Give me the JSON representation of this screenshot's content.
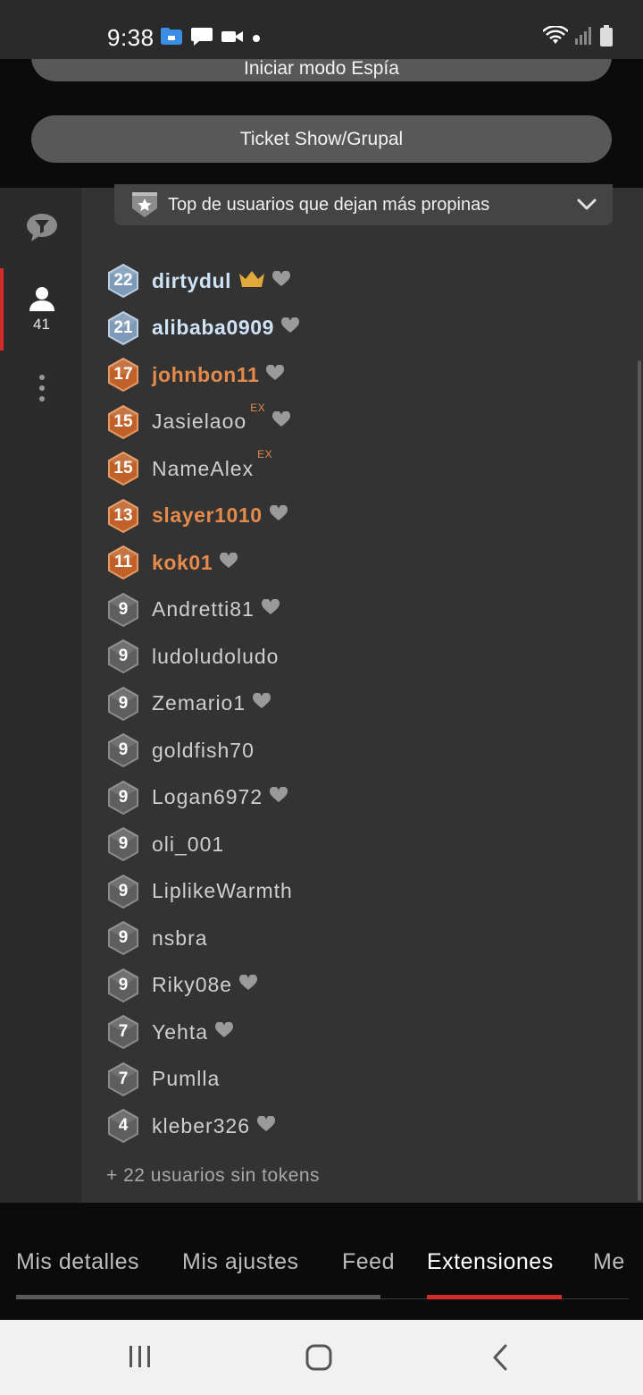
{
  "status_bar": {
    "time": "9:38",
    "left_icons": [
      "files-icon",
      "message-icon",
      "video-icon",
      "dot-icon"
    ],
    "right_icons": [
      "wifi-icon",
      "signal-icon",
      "battery-icon"
    ]
  },
  "top_buttons": {
    "spy_mode": "Iniciar modo Espía",
    "ticket_show": "Ticket Show/Grupal"
  },
  "side_rail": {
    "items": [
      {
        "name": "chat-filter-icon"
      },
      {
        "name": "users-icon",
        "count": "41",
        "active": true
      },
      {
        "name": "more-options-icon"
      }
    ]
  },
  "dropdown": {
    "label": "Top de usuarios que dejan más propinas",
    "icon": "star-badge-icon",
    "chevron": "chevron-down-icon"
  },
  "users": [
    {
      "level": "22",
      "name": "dirtydul",
      "tier": "blue",
      "crown": true,
      "heart": true,
      "ex": ""
    },
    {
      "level": "21",
      "name": "alibaba0909",
      "tier": "blue",
      "crown": false,
      "heart": true,
      "ex": ""
    },
    {
      "level": "17",
      "name": "johnbon11",
      "tier": "orange",
      "crown": false,
      "heart": true,
      "ex": ""
    },
    {
      "level": "15",
      "name": "Jasielaoo",
      "tier": "orange-badge",
      "crown": false,
      "heart": true,
      "ex": "EX"
    },
    {
      "level": "15",
      "name": "NameAlex",
      "tier": "orange-badge",
      "crown": false,
      "heart": false,
      "ex": "EX"
    },
    {
      "level": "13",
      "name": "slayer1010",
      "tier": "orange",
      "crown": false,
      "heart": true,
      "ex": ""
    },
    {
      "level": "11",
      "name": "kok01",
      "tier": "orange",
      "crown": false,
      "heart": true,
      "ex": ""
    },
    {
      "level": "9",
      "name": "Andretti81",
      "tier": "gray",
      "crown": false,
      "heart": true,
      "ex": ""
    },
    {
      "level": "9",
      "name": "ludoludoludo",
      "tier": "gray",
      "crown": false,
      "heart": false,
      "ex": ""
    },
    {
      "level": "9",
      "name": "Zemario1",
      "tier": "gray",
      "crown": false,
      "heart": true,
      "ex": ""
    },
    {
      "level": "9",
      "name": "goldfish70",
      "tier": "gray",
      "crown": false,
      "heart": false,
      "ex": ""
    },
    {
      "level": "9",
      "name": "Logan6972",
      "tier": "gray",
      "crown": false,
      "heart": true,
      "ex": ""
    },
    {
      "level": "9",
      "name": "oli_001",
      "tier": "gray",
      "crown": false,
      "heart": false,
      "ex": ""
    },
    {
      "level": "9",
      "name": "LiplikeWarmth",
      "tier": "gray",
      "crown": false,
      "heart": false,
      "ex": ""
    },
    {
      "level": "9",
      "name": "nsbra",
      "tier": "gray",
      "crown": false,
      "heart": false,
      "ex": ""
    },
    {
      "level": "9",
      "name": "Riky08e",
      "tier": "gray",
      "crown": false,
      "heart": true,
      "ex": ""
    },
    {
      "level": "7",
      "name": "Yehta",
      "tier": "gray",
      "crown": false,
      "heart": true,
      "ex": ""
    },
    {
      "level": "7",
      "name": "Pumlla",
      "tier": "gray",
      "crown": false,
      "heart": false,
      "ex": ""
    },
    {
      "level": "4",
      "name": "kleber326",
      "tier": "gray",
      "crown": false,
      "heart": true,
      "ex": ""
    }
  ],
  "footer_note": "+ 22 usuarios sin tokens",
  "tabs": [
    {
      "label": "Mis detalles",
      "active": false
    },
    {
      "label": "Mis ajustes",
      "active": false
    },
    {
      "label": "Feed",
      "active": false
    },
    {
      "label": "Extensiones",
      "active": true
    },
    {
      "label": "Me",
      "active": false
    }
  ],
  "colors": {
    "accent_red": "#d62b2b",
    "name_blue": "#cfe3f7",
    "name_orange": "#e48a4a",
    "name_gray": "#cfcfcf",
    "badge_blue": "#7f9ab8",
    "badge_orange": "#c0612a",
    "badge_gray": "#5e5e5e"
  },
  "nav_bar": {
    "buttons": [
      "recents-icon",
      "home-icon",
      "back-icon"
    ]
  }
}
